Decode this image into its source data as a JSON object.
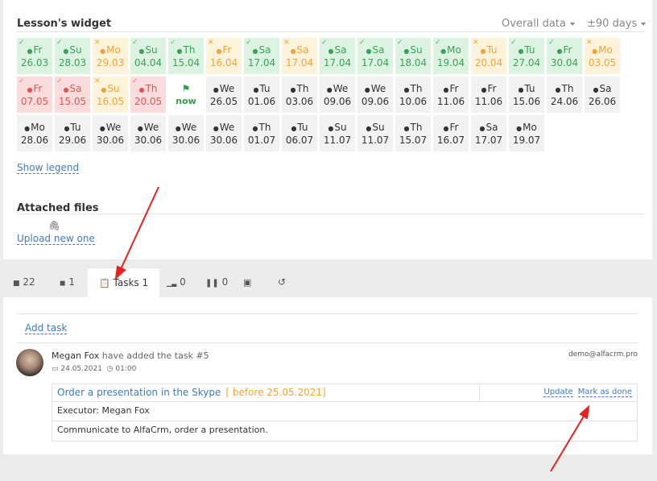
{
  "widget": {
    "title": "Lesson's widget",
    "filter1": "Overall data",
    "filter2": "±90 days"
  },
  "rows": [
    [
      {
        "day": "Fr",
        "date": "26.03",
        "c": "g",
        "mk": "✓"
      },
      {
        "day": "Su",
        "date": "28.03",
        "c": "g",
        "mk": "✓"
      },
      {
        "day": "Mo",
        "date": "29.03",
        "c": "y",
        "mk": "✕"
      },
      {
        "day": "Su",
        "date": "04.04",
        "c": "g",
        "mk": "✓"
      },
      {
        "day": "Th",
        "date": "15.04",
        "c": "g",
        "mk": "✓"
      },
      {
        "day": "Fr",
        "date": "16.04",
        "c": "y",
        "mk": "✕"
      },
      {
        "day": "Sa",
        "date": "17.04",
        "c": "g",
        "mk": "✓"
      },
      {
        "day": "Sa",
        "date": "17.04",
        "c": "y",
        "mk": "✕"
      },
      {
        "day": "Sa",
        "date": "17.04",
        "c": "g",
        "mk": "✓"
      },
      {
        "day": "Sa",
        "date": "17.04",
        "c": "g",
        "mk": "✓"
      },
      {
        "day": "Su",
        "date": "18.04",
        "c": "g",
        "mk": "✓"
      },
      {
        "day": "Mo",
        "date": "19.04",
        "c": "g",
        "mk": "✓"
      },
      {
        "day": "Tu",
        "date": "20.04",
        "c": "y",
        "mk": "✕"
      },
      {
        "day": "Tu",
        "date": "27.04",
        "c": "g",
        "mk": "✓"
      },
      {
        "day": "Fr",
        "date": "30.04",
        "c": "g",
        "mk": "✓"
      },
      {
        "day": "Mo",
        "date": "03.05",
        "c": "y",
        "mk": "✕"
      }
    ],
    [
      {
        "day": "Fr",
        "date": "07.05",
        "c": "r",
        "mk": "✓"
      },
      {
        "day": "Sa",
        "date": "15.05",
        "c": "r",
        "mk": "✓"
      },
      {
        "day": "Su",
        "date": "16.05",
        "c": "y",
        "mk": "✕"
      },
      {
        "day": "Th",
        "date": "20.05",
        "c": "r",
        "mk": "✓"
      },
      {
        "day": "",
        "date": "now",
        "c": "w",
        "mk": ""
      },
      {
        "day": "We",
        "date": "26.05",
        "c": "n",
        "mk": ""
      },
      {
        "day": "Tu",
        "date": "01.06",
        "c": "n",
        "mk": ""
      },
      {
        "day": "Th",
        "date": "03.06",
        "c": "n",
        "mk": ""
      },
      {
        "day": "We",
        "date": "09.06",
        "c": "n",
        "mk": ""
      },
      {
        "day": "We",
        "date": "09.06",
        "c": "n",
        "mk": ""
      },
      {
        "day": "Th",
        "date": "10.06",
        "c": "n",
        "mk": ""
      },
      {
        "day": "Fr",
        "date": "11.06",
        "c": "n",
        "mk": ""
      },
      {
        "day": "Fr",
        "date": "11.06",
        "c": "n",
        "mk": ""
      },
      {
        "day": "Tu",
        "date": "15.06",
        "c": "n",
        "mk": ""
      },
      {
        "day": "Th",
        "date": "24.06",
        "c": "n",
        "mk": ""
      },
      {
        "day": "Sa",
        "date": "26.06",
        "c": "n",
        "mk": ""
      }
    ],
    [
      {
        "day": "Mo",
        "date": "28.06",
        "c": "n",
        "mk": ""
      },
      {
        "day": "Tu",
        "date": "29.06",
        "c": "n",
        "mk": ""
      },
      {
        "day": "We",
        "date": "30.06",
        "c": "n",
        "mk": ""
      },
      {
        "day": "We",
        "date": "30.06",
        "c": "n",
        "mk": ""
      },
      {
        "day": "We",
        "date": "30.06",
        "c": "n",
        "mk": ""
      },
      {
        "day": "We",
        "date": "30.06",
        "c": "n",
        "mk": ""
      },
      {
        "day": "Th",
        "date": "01.07",
        "c": "n",
        "mk": ""
      },
      {
        "day": "Tu",
        "date": "06.07",
        "c": "n",
        "mk": ""
      },
      {
        "day": "Su",
        "date": "11.07",
        "c": "n",
        "mk": ""
      },
      {
        "day": "Su",
        "date": "11.07",
        "c": "n",
        "mk": ""
      },
      {
        "day": "Th",
        "date": "15.07",
        "c": "n",
        "mk": ""
      },
      {
        "day": "Fr",
        "date": "16.07",
        "c": "n",
        "mk": ""
      },
      {
        "day": "Sa",
        "date": "17.07",
        "c": "n",
        "mk": ""
      },
      {
        "day": "Mo",
        "date": "19.07",
        "c": "n",
        "mk": ""
      }
    ]
  ],
  "legend_link": "Show legend",
  "files": {
    "title": "Attached files",
    "upload": "Upload new one"
  },
  "tabs": {
    "comments": "22",
    "notes": "1",
    "tasks": "Tasks 1",
    "stats": "0",
    "pauses": "0"
  },
  "tasks": {
    "add": "Add task",
    "author": "Megan Fox",
    "action": "have added the task #5",
    "date": "24.05.2021",
    "time": "01:00",
    "email": "demo@alfacrm.pro",
    "task_title": "Order a presentation in the Skype",
    "due": "[ before 25.05.2021]",
    "update": "Update",
    "done": "Mark as done",
    "executor": "Executor: Megan Fox",
    "description": "Communicate to AlfaCrm, order a presentation."
  }
}
